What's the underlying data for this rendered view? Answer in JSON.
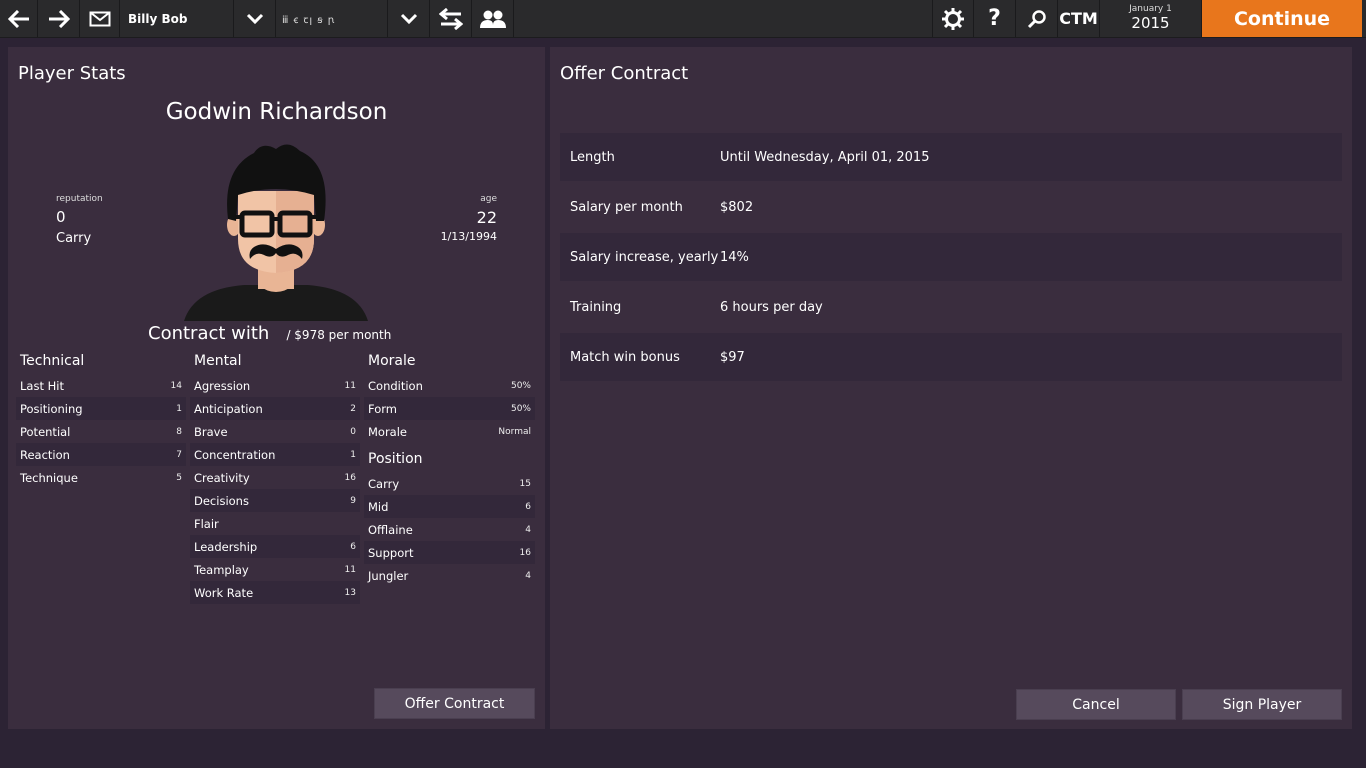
{
  "topbar": {
    "manager_name": "Billy Bob",
    "team_name": "ⅲ ꞓ  ꞇꞁ ꞩ ꞃ",
    "ctm_label": "CTM",
    "date_line1": "January 1",
    "date_line2": "2015",
    "continue_label": "Continue",
    "accent_color": "#e8761c"
  },
  "player_stats": {
    "title": "Player Stats",
    "name": "Godwin Richardson",
    "reputation_label": "reputation",
    "reputation_value": "0",
    "role": "Carry",
    "age_label": "age",
    "age_value": "22",
    "dob": "1/13/1994",
    "contract_with": "Contract with",
    "contract_salary": "/ $978 per month",
    "technical": {
      "title": "Technical",
      "rows": [
        {
          "name": "Last Hit",
          "value": "14"
        },
        {
          "name": "Positioning",
          "value": "1"
        },
        {
          "name": "Potential",
          "value": "8"
        },
        {
          "name": "Reaction",
          "value": "7"
        },
        {
          "name": "Technique",
          "value": "5"
        }
      ]
    },
    "mental": {
      "title": "Mental",
      "rows": [
        {
          "name": "Agression",
          "value": "11"
        },
        {
          "name": "Anticipation",
          "value": "2"
        },
        {
          "name": "Brave",
          "value": "0"
        },
        {
          "name": "Concentration",
          "value": "1"
        },
        {
          "name": "Creativity",
          "value": "16"
        },
        {
          "name": "Decisions",
          "value": "9"
        },
        {
          "name": "Flair",
          "value": ""
        },
        {
          "name": "Leadership",
          "value": "6"
        },
        {
          "name": "Teamplay",
          "value": "11"
        },
        {
          "name": "Work Rate",
          "value": "13"
        }
      ]
    },
    "morale": {
      "title": "Morale",
      "rows": [
        {
          "name": "Condition",
          "value": "50%"
        },
        {
          "name": "Form",
          "value": "50%"
        },
        {
          "name": "Morale",
          "value": "Normal"
        }
      ]
    },
    "position": {
      "title": "Position",
      "rows": [
        {
          "name": "Carry",
          "value": "15"
        },
        {
          "name": "Mid",
          "value": "6"
        },
        {
          "name": "Offlaine",
          "value": "4"
        },
        {
          "name": "Support",
          "value": "16"
        },
        {
          "name": "Jungler",
          "value": "4"
        }
      ]
    },
    "offer_button": "Offer Contract"
  },
  "offer_contract": {
    "title": "Offer Contract",
    "rows": [
      {
        "label": "Length",
        "value": "Until Wednesday, April 01, 2015"
      },
      {
        "label": "Salary per month",
        "value": "$802"
      },
      {
        "label": "Salary increase, yearly",
        "value": "14%"
      },
      {
        "label": "Training",
        "value": "6 hours per day"
      },
      {
        "label": "Match win bonus",
        "value": "$97"
      }
    ],
    "cancel_button": "Cancel",
    "sign_button": "Sign Player"
  }
}
